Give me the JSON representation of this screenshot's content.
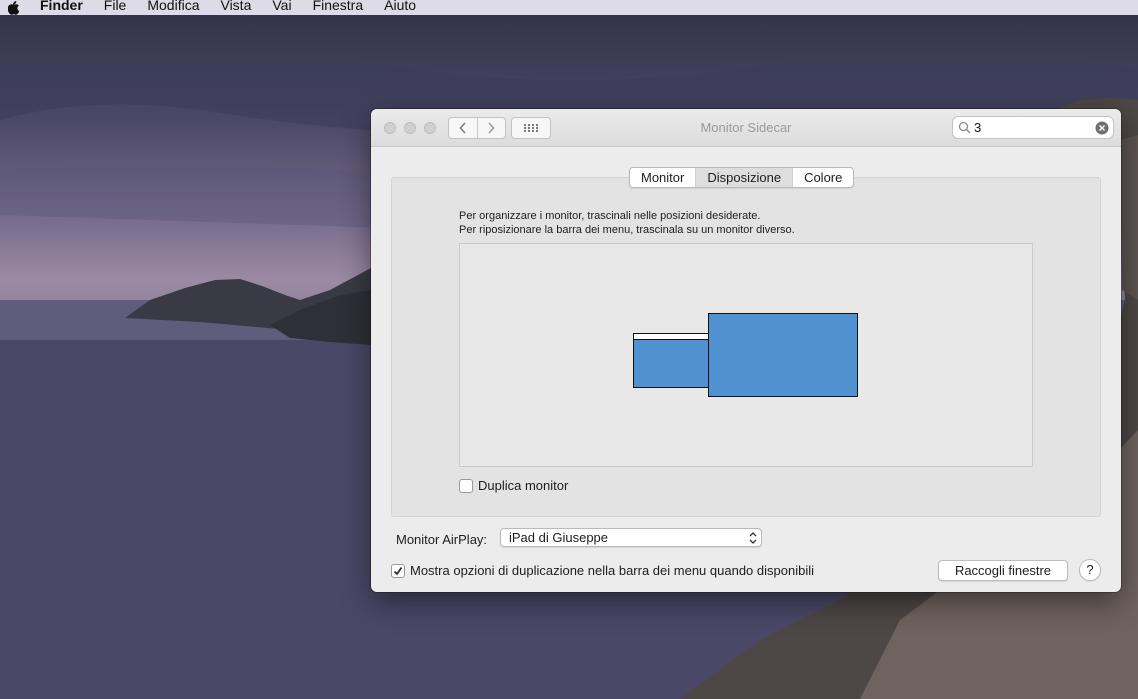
{
  "menubar": {
    "app": "Finder",
    "items": [
      "File",
      "Modifica",
      "Vista",
      "Vai",
      "Finestra",
      "Aiuto"
    ]
  },
  "window": {
    "title": "Monitor Sidecar",
    "search_value": "3"
  },
  "tabs": [
    {
      "label": "Monitor",
      "active": false
    },
    {
      "label": "Disposizione",
      "active": true
    },
    {
      "label": "Colore",
      "active": false
    }
  ],
  "arrangement": {
    "instruction_line1": "Per organizzare i monitor, trascinali nelle posizioni desiderate.",
    "instruction_line2": "Per riposizionare la barra dei menu, trascinala su un monitor diverso."
  },
  "mirror_checkbox": {
    "label": "Duplica monitor",
    "checked": false
  },
  "airplay": {
    "label": "Monitor AirPlay:",
    "selected": "iPad di Giuseppe"
  },
  "menubar_option": {
    "label": "Mostra opzioni di duplicazione nella barra dei menu quando disponibili",
    "checked": true
  },
  "gather_button": {
    "label": "Raccogli finestre"
  },
  "help_button": {
    "label": "?"
  },
  "colors": {
    "monitor_fill": "#4f91d1",
    "window_bg": "#ececec"
  }
}
